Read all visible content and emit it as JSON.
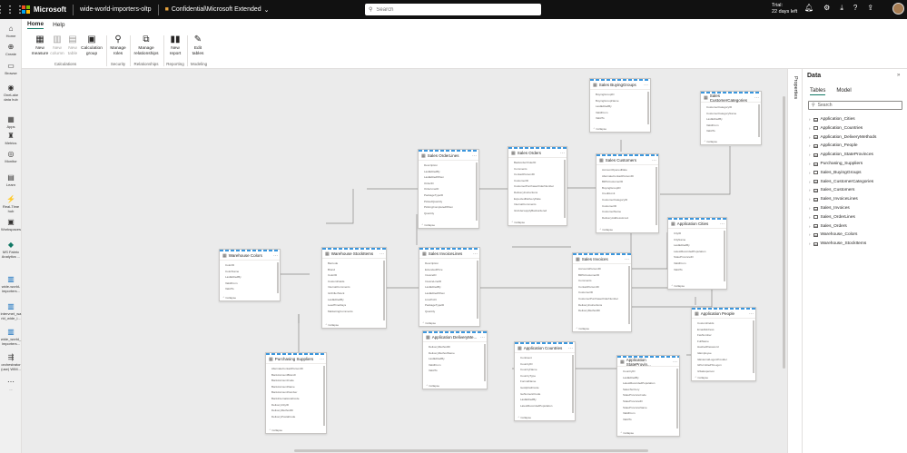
{
  "topbar": {
    "brand": "Microsoft",
    "workspace": "wide-world-importers-oltp",
    "sensitivity": "Confidential\\Microsoft Extended",
    "search_placeholder": "Search",
    "trial_line1": "Trial:",
    "trial_line2": "22 days left"
  },
  "leftnav": [
    {
      "label": "Home",
      "icon": "home-icon"
    },
    {
      "label": "Create",
      "icon": "plus-icon"
    },
    {
      "label": "Browse",
      "icon": "folder-icon"
    },
    {
      "label": "OneLake data hub",
      "icon": "onelake-icon"
    },
    {
      "label": "Apps",
      "icon": "apps-icon"
    },
    {
      "label": "Metrics",
      "icon": "trophy-icon"
    },
    {
      "label": "Monitor",
      "icon": "monitor-icon"
    },
    {
      "label": "Learn",
      "icon": "book-icon"
    },
    {
      "label": "Real-Time hub",
      "icon": "realtime-icon"
    },
    {
      "label": "Workspaces",
      "icon": "workspaces-icon"
    },
    {
      "label": "MS Fabric Analytics ...",
      "icon": "fabric-icon"
    },
    {
      "label": "wide-world-importers...",
      "icon": "dataset-icon"
    },
    {
      "label": "intervnet_wa rld_wide_i...",
      "icon": "dataset-icon"
    },
    {
      "label": "wide_world_ importers...",
      "icon": "dataset-icon"
    },
    {
      "label": "orchestrator (use) WIM...",
      "icon": "pipeline-icon"
    },
    {
      "label": "...",
      "icon": "more-icon"
    }
  ],
  "ribbon": {
    "tabs": [
      "Home",
      "Help"
    ],
    "buttons": [
      {
        "label": "New measure",
        "icon": "measure-icon",
        "enabled": true
      },
      {
        "label": "New column",
        "icon": "column-icon",
        "enabled": false
      },
      {
        "label": "New table",
        "icon": "table-icon",
        "enabled": false
      },
      {
        "label": "Calculation group",
        "icon": "calc-group-icon",
        "enabled": true
      },
      {
        "label": "Manage roles",
        "icon": "roles-icon",
        "enabled": true
      },
      {
        "label": "Manage relationships",
        "icon": "relationships-icon",
        "enabled": true
      },
      {
        "label": "New report",
        "icon": "report-icon",
        "enabled": true
      },
      {
        "label": "Edit tables",
        "icon": "edit-tables-icon",
        "enabled": true
      }
    ],
    "groups": [
      "Calculations",
      "Security",
      "Relationships",
      "Reporting",
      "Modeling"
    ]
  },
  "canvas": {
    "collapse_label": "Collapse",
    "tables": [
      {
        "name": "Sales BuyingGroups",
        "fields": [
          "BuyingGroupID",
          "BuyingGroupName",
          "LastEditedBy",
          "ValidFrom",
          "ValidTo"
        ]
      },
      {
        "name": "Sales CustomerCategories",
        "fields": [
          "CustomerCategoryID",
          "CustomerCategoryName",
          "LastEditedBy",
          "ValidFrom",
          "ValidTo"
        ]
      },
      {
        "name": "Sales OrderLines",
        "fields": [
          "Description",
          "LastEditedBy",
          "LastEditedWhen",
          "OrderID",
          "OrderLineID",
          "PackageTypeID",
          "PickedQuantity",
          "PickingCompletedWhen",
          "Quantity"
        ]
      },
      {
        "name": "Sales Orders",
        "fields": [
          "BackorderOrderID",
          "Comments",
          "ContactPersonID",
          "CustomerID",
          "CustomerPurchaseOrderNumber",
          "DeliveryInstructions",
          "ExpectedDeliveryDate",
          "InternalComments",
          "IsUndersupplyBackordered"
        ]
      },
      {
        "name": "Sales Customers",
        "fields": [
          "AccountOpenedDate",
          "AlternateContactPersonID",
          "BillToCustomerID",
          "BuyingGroupID",
          "CreditLimit",
          "CustomerCategoryID",
          "CustomerID",
          "CustomerName",
          "DeliveryAddressLine1"
        ]
      },
      {
        "name": "Application Cities",
        "fields": [
          "CityID",
          "CityName",
          "LastEditedBy",
          "LatestRecordedPopulation",
          "StateProvinceID",
          "ValidFrom",
          "ValidTo"
        ]
      },
      {
        "name": "Warehouse Colors",
        "fields": [
          "ColorID",
          "ColorName",
          "LastEditedBy",
          "ValidFrom",
          "ValidTo"
        ]
      },
      {
        "name": "Warehouse StockItems",
        "fields": [
          "Barcode",
          "Brand",
          "ColorID",
          "CustomFields",
          "InternalComments",
          "IsChillerStock",
          "LastEditedBy",
          "LeadTimeDays",
          "MarketingComments"
        ]
      },
      {
        "name": "Sales InvoiceLines",
        "fields": [
          "Description",
          "ExtendedPrice",
          "InvoiceID",
          "InvoiceLineID",
          "LastEditedBy",
          "LastEditedWhen",
          "LineProfit",
          "PackageTypeID",
          "Quantity"
        ]
      },
      {
        "name": "Sales Invoices",
        "fields": [
          "AccountsPersonID",
          "BillToCustomerID",
          "Comments",
          "ContactPersonID",
          "CustomerID",
          "CustomerPurchaseOrderNumber",
          "DeliveryInstructions",
          "DeliveryMethodID"
        ]
      },
      {
        "name": "Application People",
        "fields": [
          "CustomFields",
          "EmailAddress",
          "FaxNumber",
          "FullName",
          "HashedPassword",
          "IsEmployee",
          "IsExternalLogonProvider",
          "IsPermittedToLogon",
          "IsSalesperson",
          "IsSystemUser"
        ]
      },
      {
        "name": "Application DeliveryMe...",
        "fields": [
          "DeliveryMethodID",
          "DeliveryMethodName",
          "LastEditedBy",
          "ValidFrom",
          "ValidTo"
        ]
      },
      {
        "name": "Application Countries",
        "fields": [
          "Continent",
          "CountryID",
          "CountryName",
          "CountryType",
          "FormalName",
          "IsoAlpha3Code",
          "IsoNumericCode",
          "LastEditedBy",
          "LatestRecordedPopulation"
        ]
      },
      {
        "name": "Application StateProvin...",
        "fields": [
          "CountryID",
          "LastEditedBy",
          "LatestRecordedPopulation",
          "SalesTerritory",
          "StateProvinceCode",
          "StateProvinceID",
          "StateProvinceName",
          "ValidFrom",
          "ValidTo"
        ]
      },
      {
        "name": "Purchasing Suppliers",
        "fields": [
          "AlternateContactPersonID",
          "BankAccountBranch",
          "BankAccountCode",
          "BankAccountName",
          "BankAccountNumber",
          "BankInternationalCode",
          "DeliveryCityID",
          "DeliveryMethodID",
          "DeliveryPostalCode"
        ]
      }
    ]
  },
  "properties_label": "Properties",
  "data_panel": {
    "title": "Data",
    "tabs": [
      "Tables",
      "Model"
    ],
    "search_placeholder": "Search",
    "tables": [
      "Application_Cities",
      "Application_Countries",
      "Application_DeliveryMethods",
      "Application_People",
      "Application_StateProvinces",
      "Purchasing_Suppliers",
      "Sales_BuyingGroups",
      "Sales_CustomerCategories",
      "Sales_Customers",
      "Sales_InvoiceLines",
      "Sales_Invoices",
      "Sales_OrderLines",
      "Sales_Orders",
      "Warehouse_Colors",
      "Warehouse_StockItems"
    ]
  }
}
